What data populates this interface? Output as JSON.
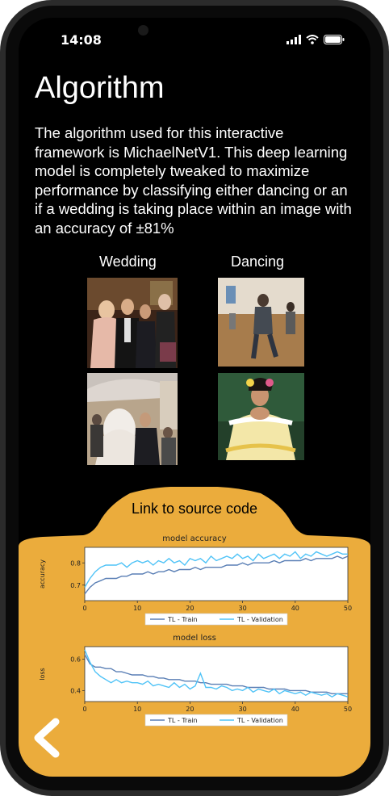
{
  "status_bar": {
    "time": "14:08"
  },
  "page": {
    "title": "Algorithm",
    "description": "The algorithm used for this interactive framework is MichaelNetV1. This deep learning model is completely tweaked to maximize performance by classifying either dancing or an if a wedding is taking place within an image with an accuracy of ±81%"
  },
  "gallery": {
    "col1_label": "Wedding",
    "col2_label": "Dancing"
  },
  "link": {
    "label": "Link to source code"
  },
  "colors": {
    "accent": "#ebac3c",
    "train": "#5a7fb5",
    "validation": "#4fc3f7"
  },
  "chart_data": [
    {
      "type": "line",
      "title": "model accuracy",
      "xlabel": "",
      "ylabel": "accuracy",
      "xlim": [
        0,
        50
      ],
      "ylim": [
        0.63,
        0.87
      ],
      "x_ticks": [
        "0",
        "10",
        "20",
        "30",
        "40",
        "50"
      ],
      "y_ticks": [
        0.7,
        0.8
      ],
      "legend": "bottom-center",
      "series": [
        {
          "name": "TL - Train",
          "values": [
            0.66,
            0.69,
            0.71,
            0.72,
            0.73,
            0.73,
            0.73,
            0.74,
            0.74,
            0.75,
            0.75,
            0.75,
            0.76,
            0.75,
            0.76,
            0.76,
            0.77,
            0.76,
            0.77,
            0.77,
            0.77,
            0.78,
            0.77,
            0.78,
            0.78,
            0.78,
            0.78,
            0.79,
            0.79,
            0.79,
            0.8,
            0.79,
            0.8,
            0.8,
            0.8,
            0.8,
            0.81,
            0.8,
            0.81,
            0.81,
            0.81,
            0.81,
            0.82,
            0.81,
            0.82,
            0.82,
            0.82,
            0.82,
            0.83,
            0.82,
            0.83
          ]
        },
        {
          "name": "TL - Validation",
          "values": [
            0.69,
            0.73,
            0.76,
            0.78,
            0.79,
            0.79,
            0.79,
            0.8,
            0.78,
            0.8,
            0.81,
            0.8,
            0.81,
            0.79,
            0.81,
            0.8,
            0.82,
            0.8,
            0.81,
            0.79,
            0.82,
            0.81,
            0.82,
            0.8,
            0.83,
            0.81,
            0.82,
            0.83,
            0.82,
            0.84,
            0.82,
            0.83,
            0.81,
            0.84,
            0.82,
            0.83,
            0.84,
            0.82,
            0.84,
            0.83,
            0.85,
            0.82,
            0.84,
            0.83,
            0.85,
            0.84,
            0.83,
            0.84,
            0.85,
            0.84,
            0.84
          ]
        }
      ]
    },
    {
      "type": "line",
      "title": "model loss",
      "xlabel": "",
      "ylabel": "loss",
      "xlim": [
        0,
        50
      ],
      "ylim": [
        0.33,
        0.68
      ],
      "x_ticks": [
        "0",
        "10",
        "20",
        "30",
        "40",
        "50"
      ],
      "y_ticks": [
        0.4,
        0.6
      ],
      "legend": "bottom-center",
      "series": [
        {
          "name": "TL - Train",
          "values": [
            0.63,
            0.57,
            0.55,
            0.55,
            0.54,
            0.54,
            0.52,
            0.52,
            0.51,
            0.5,
            0.5,
            0.5,
            0.49,
            0.49,
            0.48,
            0.48,
            0.47,
            0.47,
            0.47,
            0.46,
            0.46,
            0.46,
            0.45,
            0.45,
            0.44,
            0.44,
            0.44,
            0.44,
            0.43,
            0.43,
            0.43,
            0.42,
            0.42,
            0.42,
            0.42,
            0.41,
            0.41,
            0.41,
            0.41,
            0.4,
            0.4,
            0.4,
            0.4,
            0.39,
            0.39,
            0.39,
            0.39,
            0.38,
            0.38,
            0.38,
            0.38
          ]
        },
        {
          "name": "TL - Validation",
          "values": [
            0.66,
            0.58,
            0.52,
            0.49,
            0.47,
            0.45,
            0.47,
            0.45,
            0.46,
            0.45,
            0.45,
            0.44,
            0.46,
            0.43,
            0.44,
            0.43,
            0.42,
            0.45,
            0.42,
            0.44,
            0.41,
            0.43,
            0.51,
            0.42,
            0.42,
            0.41,
            0.43,
            0.42,
            0.4,
            0.41,
            0.4,
            0.42,
            0.39,
            0.41,
            0.4,
            0.39,
            0.41,
            0.38,
            0.4,
            0.39,
            0.38,
            0.39,
            0.37,
            0.39,
            0.38,
            0.37,
            0.38,
            0.36,
            0.38,
            0.37,
            0.36
          ]
        }
      ]
    }
  ]
}
